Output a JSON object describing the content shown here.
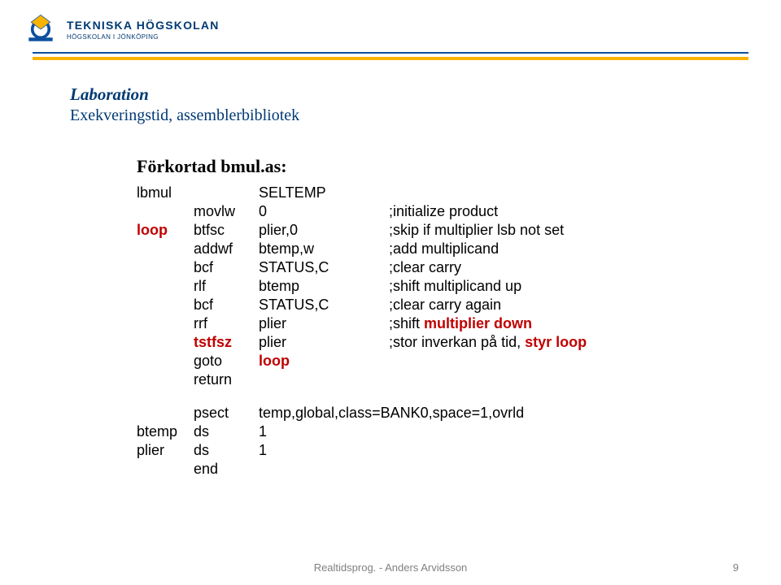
{
  "header": {
    "brand": "TEKNISKA HÖGSKOLAN",
    "brand_sub": "HÖGSKOLAN I JÖNKÖPING"
  },
  "slide": {
    "title": "Laboration",
    "subtitle": "Exekveringstid, assemblerbibliotek",
    "code_title": "Förkortad bmul.as:"
  },
  "code": {
    "rows": [
      {
        "label": "lbmul",
        "mnem": "",
        "op": "SELTEMP",
        "comment": "",
        "hl": []
      },
      {
        "label": "",
        "mnem": "movlw",
        "op": "0",
        "comment": ";initialize product",
        "hl": []
      },
      {
        "label": "loop",
        "mnem": "btfsc",
        "op": "plier,0",
        "comment": ";skip if multiplier lsb not set",
        "hl": [
          "label"
        ]
      },
      {
        "label": "",
        "mnem": "addwf",
        "op": "btemp,w",
        "comment": ";add multiplicand",
        "hl": []
      },
      {
        "label": "",
        "mnem": "bcf",
        "op": "STATUS,C",
        "comment": ";clear carry",
        "hl": []
      },
      {
        "label": "",
        "mnem": "rlf",
        "op": "btemp",
        "comment": ";shift multiplicand up",
        "hl": []
      },
      {
        "label": "",
        "mnem": "bcf",
        "op": "STATUS,C",
        "comment": ";clear carry again",
        "hl": []
      },
      {
        "label": "",
        "mnem": "rrf",
        "op": "plier",
        "comment": ";shift multiplier down",
        "hl": [
          "comment"
        ]
      },
      {
        "label": "",
        "mnem": "tstfsz",
        "op": "plier",
        "comment": ";stor inverkan på tid, styr loop",
        "hl": [
          "mnem",
          "comment"
        ]
      },
      {
        "label": "",
        "mnem": "goto",
        "op": "loop",
        "comment": "",
        "hl": [
          "op"
        ]
      },
      {
        "label": "",
        "mnem": "return",
        "op": "",
        "comment": "",
        "hl": []
      }
    ],
    "tail": [
      {
        "label": "",
        "mnem": "psect",
        "op": "temp,global,class=BANK0,space=1,ovrld",
        "comment": "",
        "hl": []
      },
      {
        "label": "btemp",
        "mnem": "ds",
        "op": "1",
        "comment": "",
        "hl": []
      },
      {
        "label": "plier",
        "mnem": "ds",
        "op": "1",
        "comment": "",
        "hl": []
      },
      {
        "label": "",
        "mnem": "end",
        "op": "",
        "comment": "",
        "hl": []
      }
    ]
  },
  "footer": {
    "text": "Realtidsprog. - Anders Arvidsson",
    "page": "9"
  }
}
